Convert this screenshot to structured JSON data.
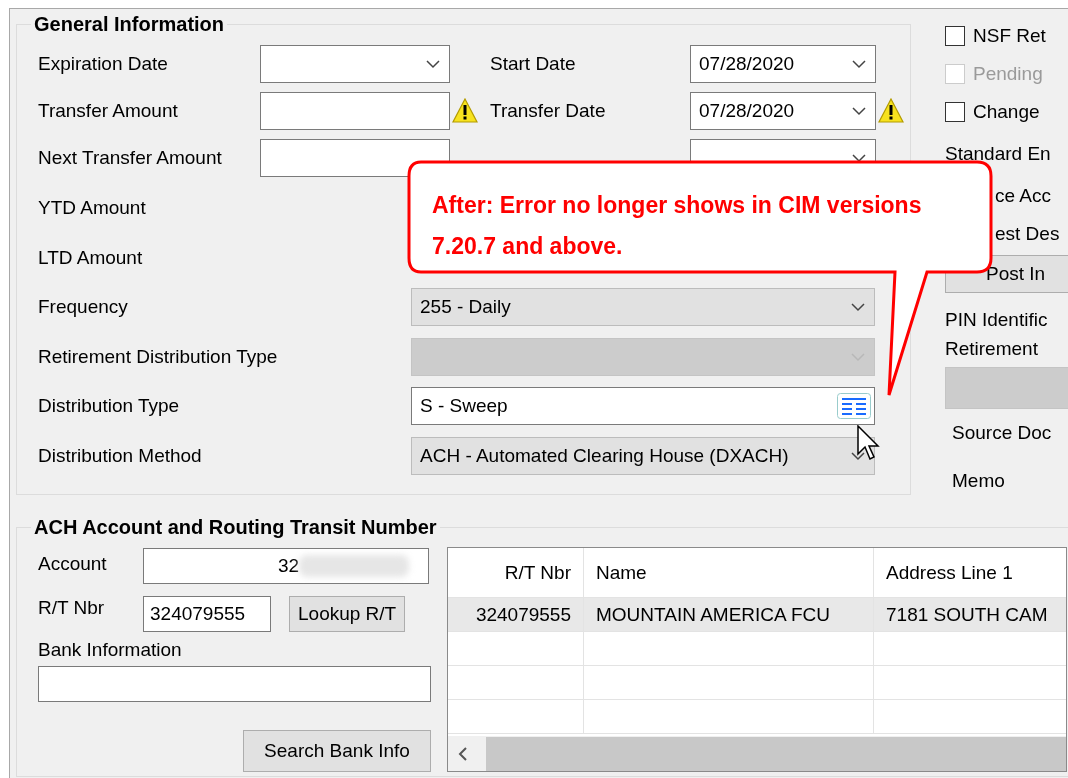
{
  "general_information": {
    "title": "General Information",
    "top_left": [
      {
        "label": "Expiration Date",
        "kind": "dropdown",
        "warning": false
      },
      {
        "label": "Transfer Amount",
        "kind": "text",
        "warning": true
      },
      {
        "label": "Next Transfer Amount",
        "kind": "text",
        "warning": false
      }
    ],
    "top_right": [
      {
        "label": "Start Date",
        "kind": "dropdown",
        "value": "07/28/2020",
        "warning": false
      },
      {
        "label": "Transfer Date",
        "kind": "dropdown",
        "value": "07/28/2020",
        "warning": true
      },
      {
        "kind": "dropdown",
        "warning": false
      }
    ],
    "lower": [
      {
        "label": "YTD Amount",
        "kind": "hidden"
      },
      {
        "label": "LTD Amount",
        "kind": "hidden"
      },
      {
        "label": "Frequency",
        "kind": "dropdown",
        "value": "255 - Daily",
        "readonly": true,
        "disabled": false
      },
      {
        "label": "Retirement Distribution Type",
        "kind": "dropdown",
        "readonly": true,
        "disabled": true
      },
      {
        "label": "Distribution Type",
        "kind": "lookup",
        "value": "S - Sweep",
        "readonly": false,
        "disabled": false
      },
      {
        "label": "Distribution Method",
        "kind": "dropdown",
        "value": "ACH - Automated Clearing House (DXACH)",
        "readonly": true,
        "disabled": false
      }
    ]
  },
  "side_panel": [
    {
      "kind": "checkbox",
      "label": "NSF Ret",
      "checked": false,
      "disabled": false
    },
    {
      "kind": "checkbox",
      "label": "Pending",
      "checked": false,
      "disabled": true
    },
    {
      "kind": "checkbox",
      "label": "Change",
      "checked": false,
      "disabled": false
    },
    {
      "kind": "label",
      "label": "Standard En"
    },
    {
      "kind": "label",
      "label": "ce Acc"
    },
    {
      "kind": "label",
      "label": "est Des"
    },
    {
      "kind": "button",
      "label": "Post In"
    },
    {
      "kind": "label",
      "label": "PIN Identific"
    },
    {
      "kind": "label",
      "label": "Retirement"
    },
    {
      "kind": "field"
    },
    {
      "kind": "label",
      "label": "Source Doc"
    },
    {
      "kind": "label",
      "label": "Memo"
    }
  ],
  "callout": {
    "text": "After: Error no longer shows in CIM versions 7.20.7 and above."
  },
  "ach": {
    "title": "ACH Account and Routing Transit Number",
    "account": {
      "label": "Account",
      "value": "32",
      "blurred": true
    },
    "rt_nbr": {
      "label": "R/T Nbr",
      "value": "324079555"
    },
    "lookup_button": "Lookup R/T",
    "bank_info": {
      "label": "Bank Information"
    },
    "search_button": "Search Bank Info",
    "table": {
      "columns": [
        "R/T Nbr",
        "Name",
        "Address Line 1"
      ],
      "rows": [
        {
          "cells": [
            "324079555",
            "MOUNTAIN AMERICA FCU",
            "7181 SOUTH CAM"
          ],
          "selected": true
        }
      ]
    }
  }
}
